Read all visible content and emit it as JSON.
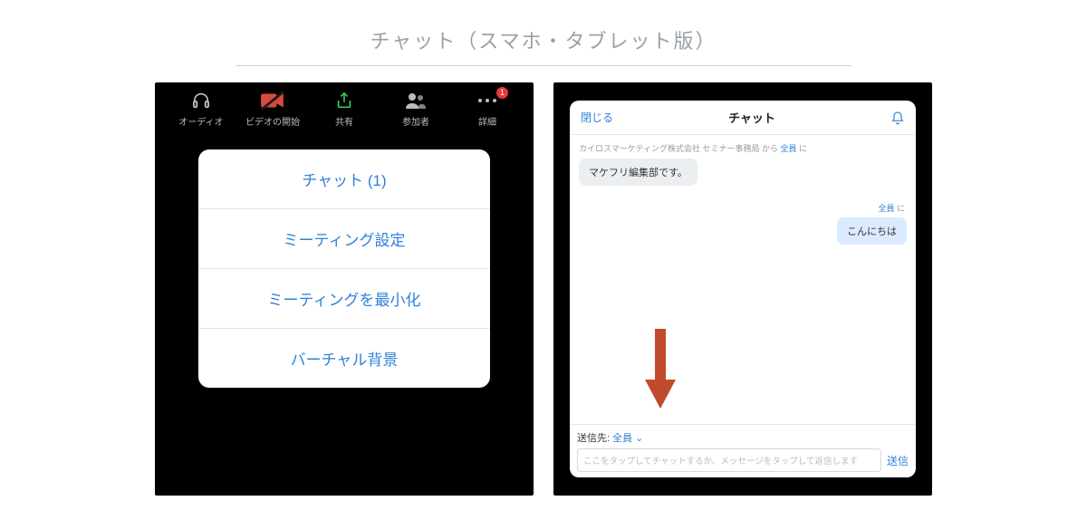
{
  "pageTitle": "チャット（スマホ・タブレット版）",
  "left": {
    "toolbar": {
      "audio": {
        "label": "オーディオ"
      },
      "video": {
        "label": "ビデオの開始"
      },
      "share": {
        "label": "共有"
      },
      "participants": {
        "label": "参加者"
      },
      "more": {
        "label": "詳細",
        "badge": "1"
      }
    },
    "popover": {
      "items": [
        "チャット (1)",
        "ミーティング設定",
        "ミーティングを最小化",
        "バーチャル背景"
      ]
    }
  },
  "right": {
    "header": {
      "close": "閉じる",
      "title": "チャット"
    },
    "incoming": {
      "meta_prefix": "カイロスマーケティング株式会社 セミナー事務局",
      "meta_mid": " から ",
      "meta_target": "全員",
      "meta_suffix": " に",
      "text": "マケフリ編集部です。"
    },
    "outgoing": {
      "meta_target": "全員",
      "meta_suffix": " に",
      "text": "こんにちは"
    },
    "footer": {
      "sendto_label": "送信先: ",
      "sendto_value": "全員",
      "placeholder": "ここをタップしてチャットするか、メッセージをタップして返信します",
      "send": "送信"
    }
  }
}
